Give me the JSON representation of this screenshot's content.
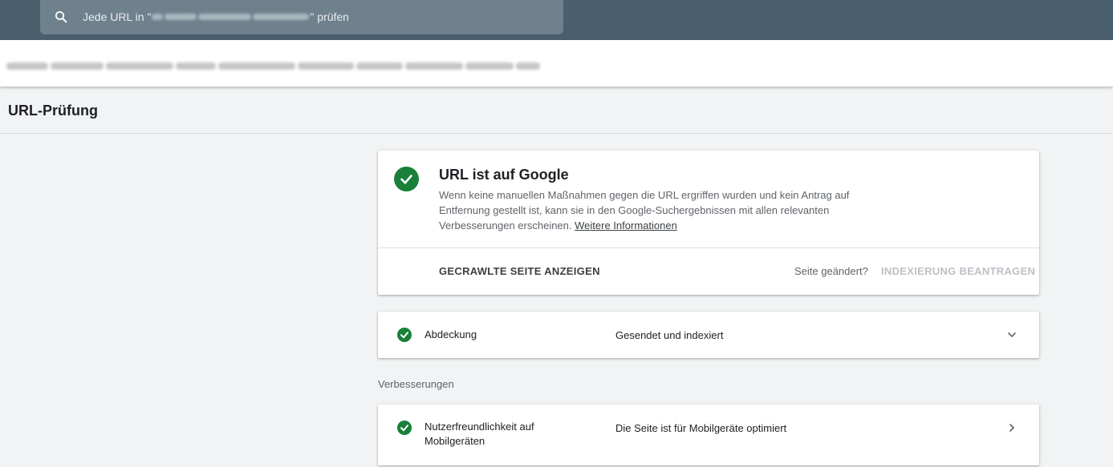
{
  "search": {
    "prefix": "Jede URL in \"",
    "suffix": "\" prüfen"
  },
  "page": {
    "title": "URL-Prüfung"
  },
  "status_card": {
    "title": "URL ist auf Google",
    "description": "Wenn keine manuellen Maßnahmen gegen die URL ergriffen wurden und kein Antrag auf Entfernung gestellt ist, kann sie in den Google-Suchergebnissen mit allen relevanten Verbesserungen erscheinen.",
    "link": "Weitere Informationen",
    "crawled_button": "GECRAWLTE SEITE ANZEIGEN",
    "changed_question": "Seite geändert?",
    "index_button": "INDEXIERUNG BEANTRAGEN",
    "status_color": "#188038"
  },
  "coverage": {
    "label": "Abdeckung",
    "value": "Gesendet und indexiert",
    "icon": "chevron-down-icon"
  },
  "enhancements": {
    "section_label": "Verbesserungen",
    "items": [
      {
        "label_line1": "Nutzerfreundlichkeit auf",
        "label_line2": "Mobilgeräten",
        "value": "Die Seite ist für Mobilgeräte optimiert",
        "icon": "chevron-right-icon"
      }
    ]
  }
}
